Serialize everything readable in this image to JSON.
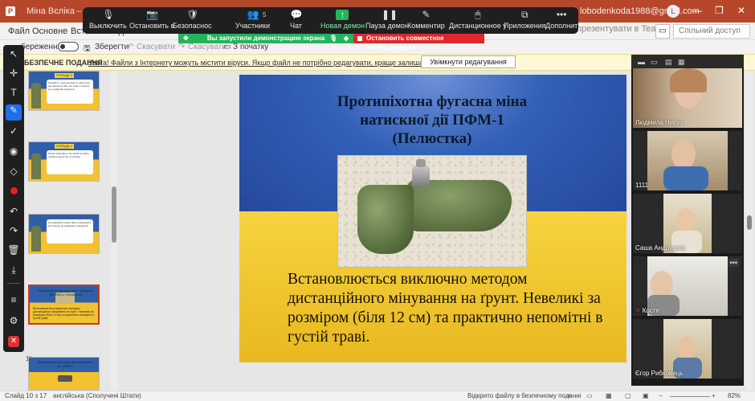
{
  "window": {
    "doc_title": "Міна Вєліка",
    "doc_sep": "–",
    "account": "lobodenkoda1988@gmail.com",
    "avatar": "L",
    "buttons": [
      "—",
      "❐",
      "✕"
    ]
  },
  "menu": {
    "items": [
      "Файл",
      "Основне",
      "Встав",
      "Вигляд"
    ],
    "teams": "презентувати в Teams",
    "share": "Спільний доступ"
  },
  "toolbar2": {
    "protected_label": "береження",
    "save": "Зберегти",
    "undo": "Скасувати",
    "redo": "Скасувати",
    "from_start": "З початку"
  },
  "zoom_controls": [
    {
      "label": "Выключить",
      "icon": "mic-icon",
      "glyph": "🎙"
    },
    {
      "label": "Остановить в",
      "icon": "video-icon",
      "glyph": "📷"
    },
    {
      "label": "Безопаснос",
      "icon": "shield-icon",
      "glyph": "🛡"
    },
    {
      "label": "Участники",
      "icon": "participants-icon",
      "glyph": "👥",
      "count": "5"
    },
    {
      "label": "Чат",
      "icon": "chat-icon",
      "glyph": "💬"
    },
    {
      "label": "Новая демон",
      "icon": "share-screen-icon",
      "glyph": "↑",
      "active": true
    },
    {
      "label": "Пауза демон",
      "icon": "pause-icon",
      "glyph": "❚❚"
    },
    {
      "label": "Комментир",
      "icon": "annotate-icon",
      "glyph": "✎"
    },
    {
      "label": "Дистанционное у",
      "icon": "remote-control-icon",
      "glyph": "🖱"
    },
    {
      "label": "Приложения",
      "icon": "apps-icon",
      "glyph": "⧉"
    },
    {
      "label": "Дополнит",
      "icon": "more-icon",
      "glyph": "•••"
    }
  ],
  "share_banner": {
    "text": "Вы запустили демонстрацию экрана",
    "stop": "Остановить совместное использование"
  },
  "protected_view": {
    "title": "БЕЗПЕЧНЕ ПОДАННЯ",
    "message": "Увага! Файли з Інтернету можуть містити віруси. Якщо файл не потрібно редагувати, краще залишатися в безпечному поданні.",
    "enable": "Увімкнути редагування"
  },
  "thumbnails": [
    {
      "tag": "ПОРАДА 3",
      "text": "Тримай те, щоб допомогти пам'ятати, що закінчите змін. Не ходи по місцях, де є невідомі предмети."
    },
    {
      "tag": "ПОРАДА 4",
      "text": "Бачиш вибухівку? Не чіпай! Негайно повідом дорослих та поліцію."
    },
    {
      "tag": "",
      "text": "Не намагайся самостійно розмінувати. Не підходь до невідомих предметів."
    },
    {
      "title": "Протипіхотна фугасна міна натискної дії ПФМ-1 (Пелюстка)",
      "text": "Встановлюється виключно методом дистанційного мінування на ґрунт. Невеликі за розміром (біля 12 см) та практично непомітні в густій траві."
    },
    {
      "title": "Протипіхотна фугасна міна натискної дії «ПМН»",
      "text": ""
    }
  ],
  "slide_number_label": "11",
  "slide": {
    "title": "Протипіхотна фугасна міна натискної дії ПФМ-1 (Пелюстка)",
    "body": "Встановлюється виключно методом дистанційного мінування на ґрунт. Невеликі за розміром (біля 12 см) та практично непомітні в густій траві."
  },
  "participants": [
    {
      "name": "Людмила Нерух",
      "muted": false
    },
    {
      "name": "1111",
      "muted": false
    },
    {
      "name": "Саша Андрушків",
      "muted": false
    },
    {
      "name": "Костя",
      "muted": true
    },
    {
      "name": "Єгор Рибковець",
      "muted": false
    }
  ],
  "statusbar": {
    "slide": "Слайд 10 з 17",
    "lang": "англійська (Сполучені Штати)",
    "protected": "Відкрито файлу в безпечному поданні",
    "zoom": "82%"
  },
  "colors": {
    "ppt_red": "#b7472a",
    "zoom_green": "#24b35a",
    "stop_red": "#e02828",
    "annot_blue": "#1e6ee8"
  }
}
